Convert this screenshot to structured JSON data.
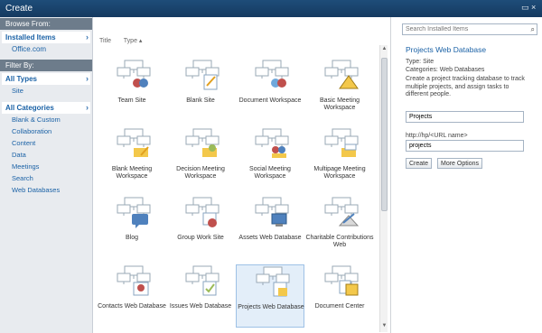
{
  "window": {
    "title": "Create",
    "close_glyph": "×"
  },
  "left": {
    "browse_header": "Browse From:",
    "browse_selected": "Installed Items",
    "browse_links": [
      "Office.com"
    ],
    "filter_header": "Filter By:",
    "type_selected": "All Types",
    "type_links": [
      "Site"
    ],
    "cat_selected": "All Categories",
    "cat_links": [
      "Blank & Custom",
      "Collaboration",
      "Content",
      "Data",
      "Meetings",
      "Search",
      "Web Databases"
    ]
  },
  "sort": {
    "title_label": "Title",
    "type_label": "Type ▴"
  },
  "items": [
    {
      "label": "Team Site",
      "icon": "team-site-icon"
    },
    {
      "label": "Blank Site",
      "icon": "blank-site-icon"
    },
    {
      "label": "Document Workspace",
      "icon": "document-workspace-icon"
    },
    {
      "label": "Basic Meeting Workspace",
      "icon": "basic-meeting-icon"
    },
    {
      "label": "Blank Meeting Workspace",
      "icon": "blank-meeting-icon"
    },
    {
      "label": "Decision Meeting Workspace",
      "icon": "decision-meeting-icon"
    },
    {
      "label": "Social Meeting Workspace",
      "icon": "social-meeting-icon"
    },
    {
      "label": "Multipage Meeting Workspace",
      "icon": "multipage-meeting-icon"
    },
    {
      "label": "Blog",
      "icon": "blog-icon"
    },
    {
      "label": "Group Work Site",
      "icon": "group-work-icon"
    },
    {
      "label": "Assets Web Database",
      "icon": "assets-db-icon"
    },
    {
      "label": "Charitable Contributions Web",
      "icon": "charitable-icon"
    },
    {
      "label": "Contacts Web Database",
      "icon": "contacts-db-icon"
    },
    {
      "label": "Issues Web Database",
      "icon": "issues-db-icon"
    },
    {
      "label": "Projects Web Database",
      "icon": "projects-db-icon",
      "selected": true
    },
    {
      "label": "Document Center",
      "icon": "document-center-icon"
    }
  ],
  "detail": {
    "search_placeholder": "Search Installed Items",
    "title": "Projects Web Database",
    "type_line": "Type: Site",
    "categories_line": "Categories: Web Databases",
    "description": "Create a project tracking database to track multiple projects, and assign tasks to different people.",
    "name_value": "Projects",
    "url_label": "http://hp/<URL name>",
    "url_value": "projects",
    "create_label": "Create",
    "more_label": "More Options"
  },
  "colors": {
    "accent": "#1b62a6",
    "titlebar": "#1e4d79",
    "section": "#6d7c8b"
  }
}
